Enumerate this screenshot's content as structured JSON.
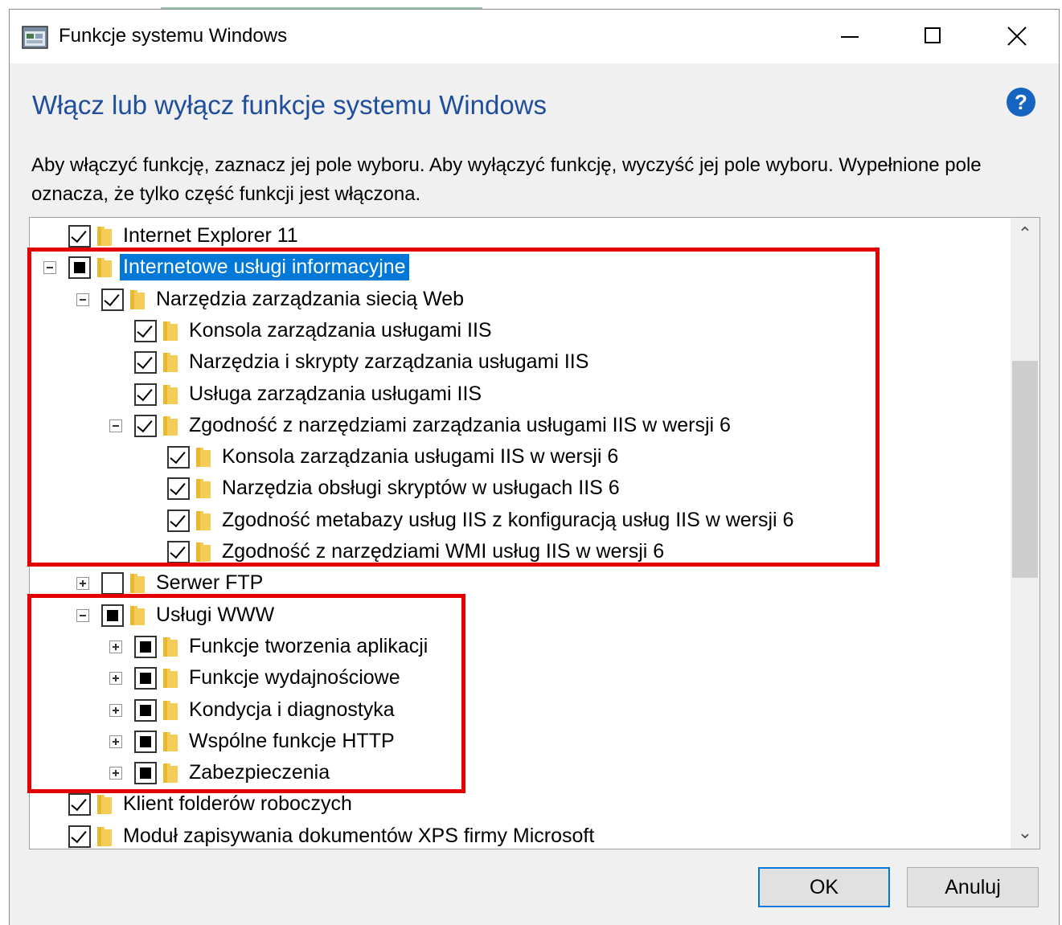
{
  "window": {
    "title": "Funkcje systemu Windows",
    "heading": "Włącz lub wyłącz funkcje systemu Windows",
    "description": "Aby włączyć funkcję, zaznacz jej pole wyboru. Aby wyłączyć funkcję, wyczyść jej pole wyboru. Wypełnione pole oznacza, że tylko część funkcji jest włączona.",
    "help_glyph": "?"
  },
  "tree": {
    "items": [
      {
        "label": "Internet Explorer 11",
        "state": "checked",
        "expander": "none",
        "level": 0
      },
      {
        "label": "Internetowe usługi informacyjne",
        "state": "partial",
        "expander": "collapse",
        "level": 0,
        "selected": true
      },
      {
        "label": "Narzędzia zarządzania siecią Web",
        "state": "checked",
        "expander": "collapse",
        "level": 1
      },
      {
        "label": "Konsola zarządzania usługami IIS",
        "state": "checked",
        "expander": "none",
        "level": 2
      },
      {
        "label": "Narzędzia i skrypty zarządzania usługami IIS",
        "state": "checked",
        "expander": "none",
        "level": 2
      },
      {
        "label": "Usługa zarządzania usługami IIS",
        "state": "checked",
        "expander": "none",
        "level": 2
      },
      {
        "label": "Zgodność z narzędziami zarządzania usługami IIS w wersji 6",
        "state": "checked",
        "expander": "collapse",
        "level": 2
      },
      {
        "label": "Konsola zarządzania usługami IIS w wersji 6",
        "state": "checked",
        "expander": "none",
        "level": 3
      },
      {
        "label": "Narzędzia obsługi skryptów w usługach IIS 6",
        "state": "checked",
        "expander": "none",
        "level": 3
      },
      {
        "label": "Zgodność metabazy usług IIS z konfiguracją usług IIS w wersji 6",
        "state": "checked",
        "expander": "none",
        "level": 3
      },
      {
        "label": "Zgodność z narzędziami WMI usług IIS w wersji 6",
        "state": "checked",
        "expander": "none",
        "level": 3
      },
      {
        "label": "Serwer FTP",
        "state": "unchecked",
        "expander": "expand",
        "level": 1
      },
      {
        "label": "Usługi WWW",
        "state": "partial",
        "expander": "collapse",
        "level": 1
      },
      {
        "label": "Funkcje tworzenia aplikacji",
        "state": "partial",
        "expander": "expand",
        "level": 2
      },
      {
        "label": "Funkcje wydajnościowe",
        "state": "partial",
        "expander": "expand",
        "level": 2
      },
      {
        "label": "Kondycja i diagnostyka",
        "state": "partial",
        "expander": "expand",
        "level": 2
      },
      {
        "label": "Wspólne funkcje HTTP",
        "state": "partial",
        "expander": "expand",
        "level": 2
      },
      {
        "label": "Zabezpieczenia",
        "state": "partial",
        "expander": "expand",
        "level": 2
      },
      {
        "label": "Klient folderów roboczych",
        "state": "checked",
        "expander": "none",
        "level": 0
      },
      {
        "label": "Moduł zapisywania dokumentów XPS firmy Microsoft",
        "state": "checked",
        "expander": "none",
        "level": 0
      }
    ]
  },
  "buttons": {
    "ok": "OK",
    "cancel": "Anuluj"
  },
  "colors": {
    "heading": "#1f4e9c",
    "selection": "#0078d7",
    "highlight": "#e20000",
    "folder": "#f4cd58"
  }
}
